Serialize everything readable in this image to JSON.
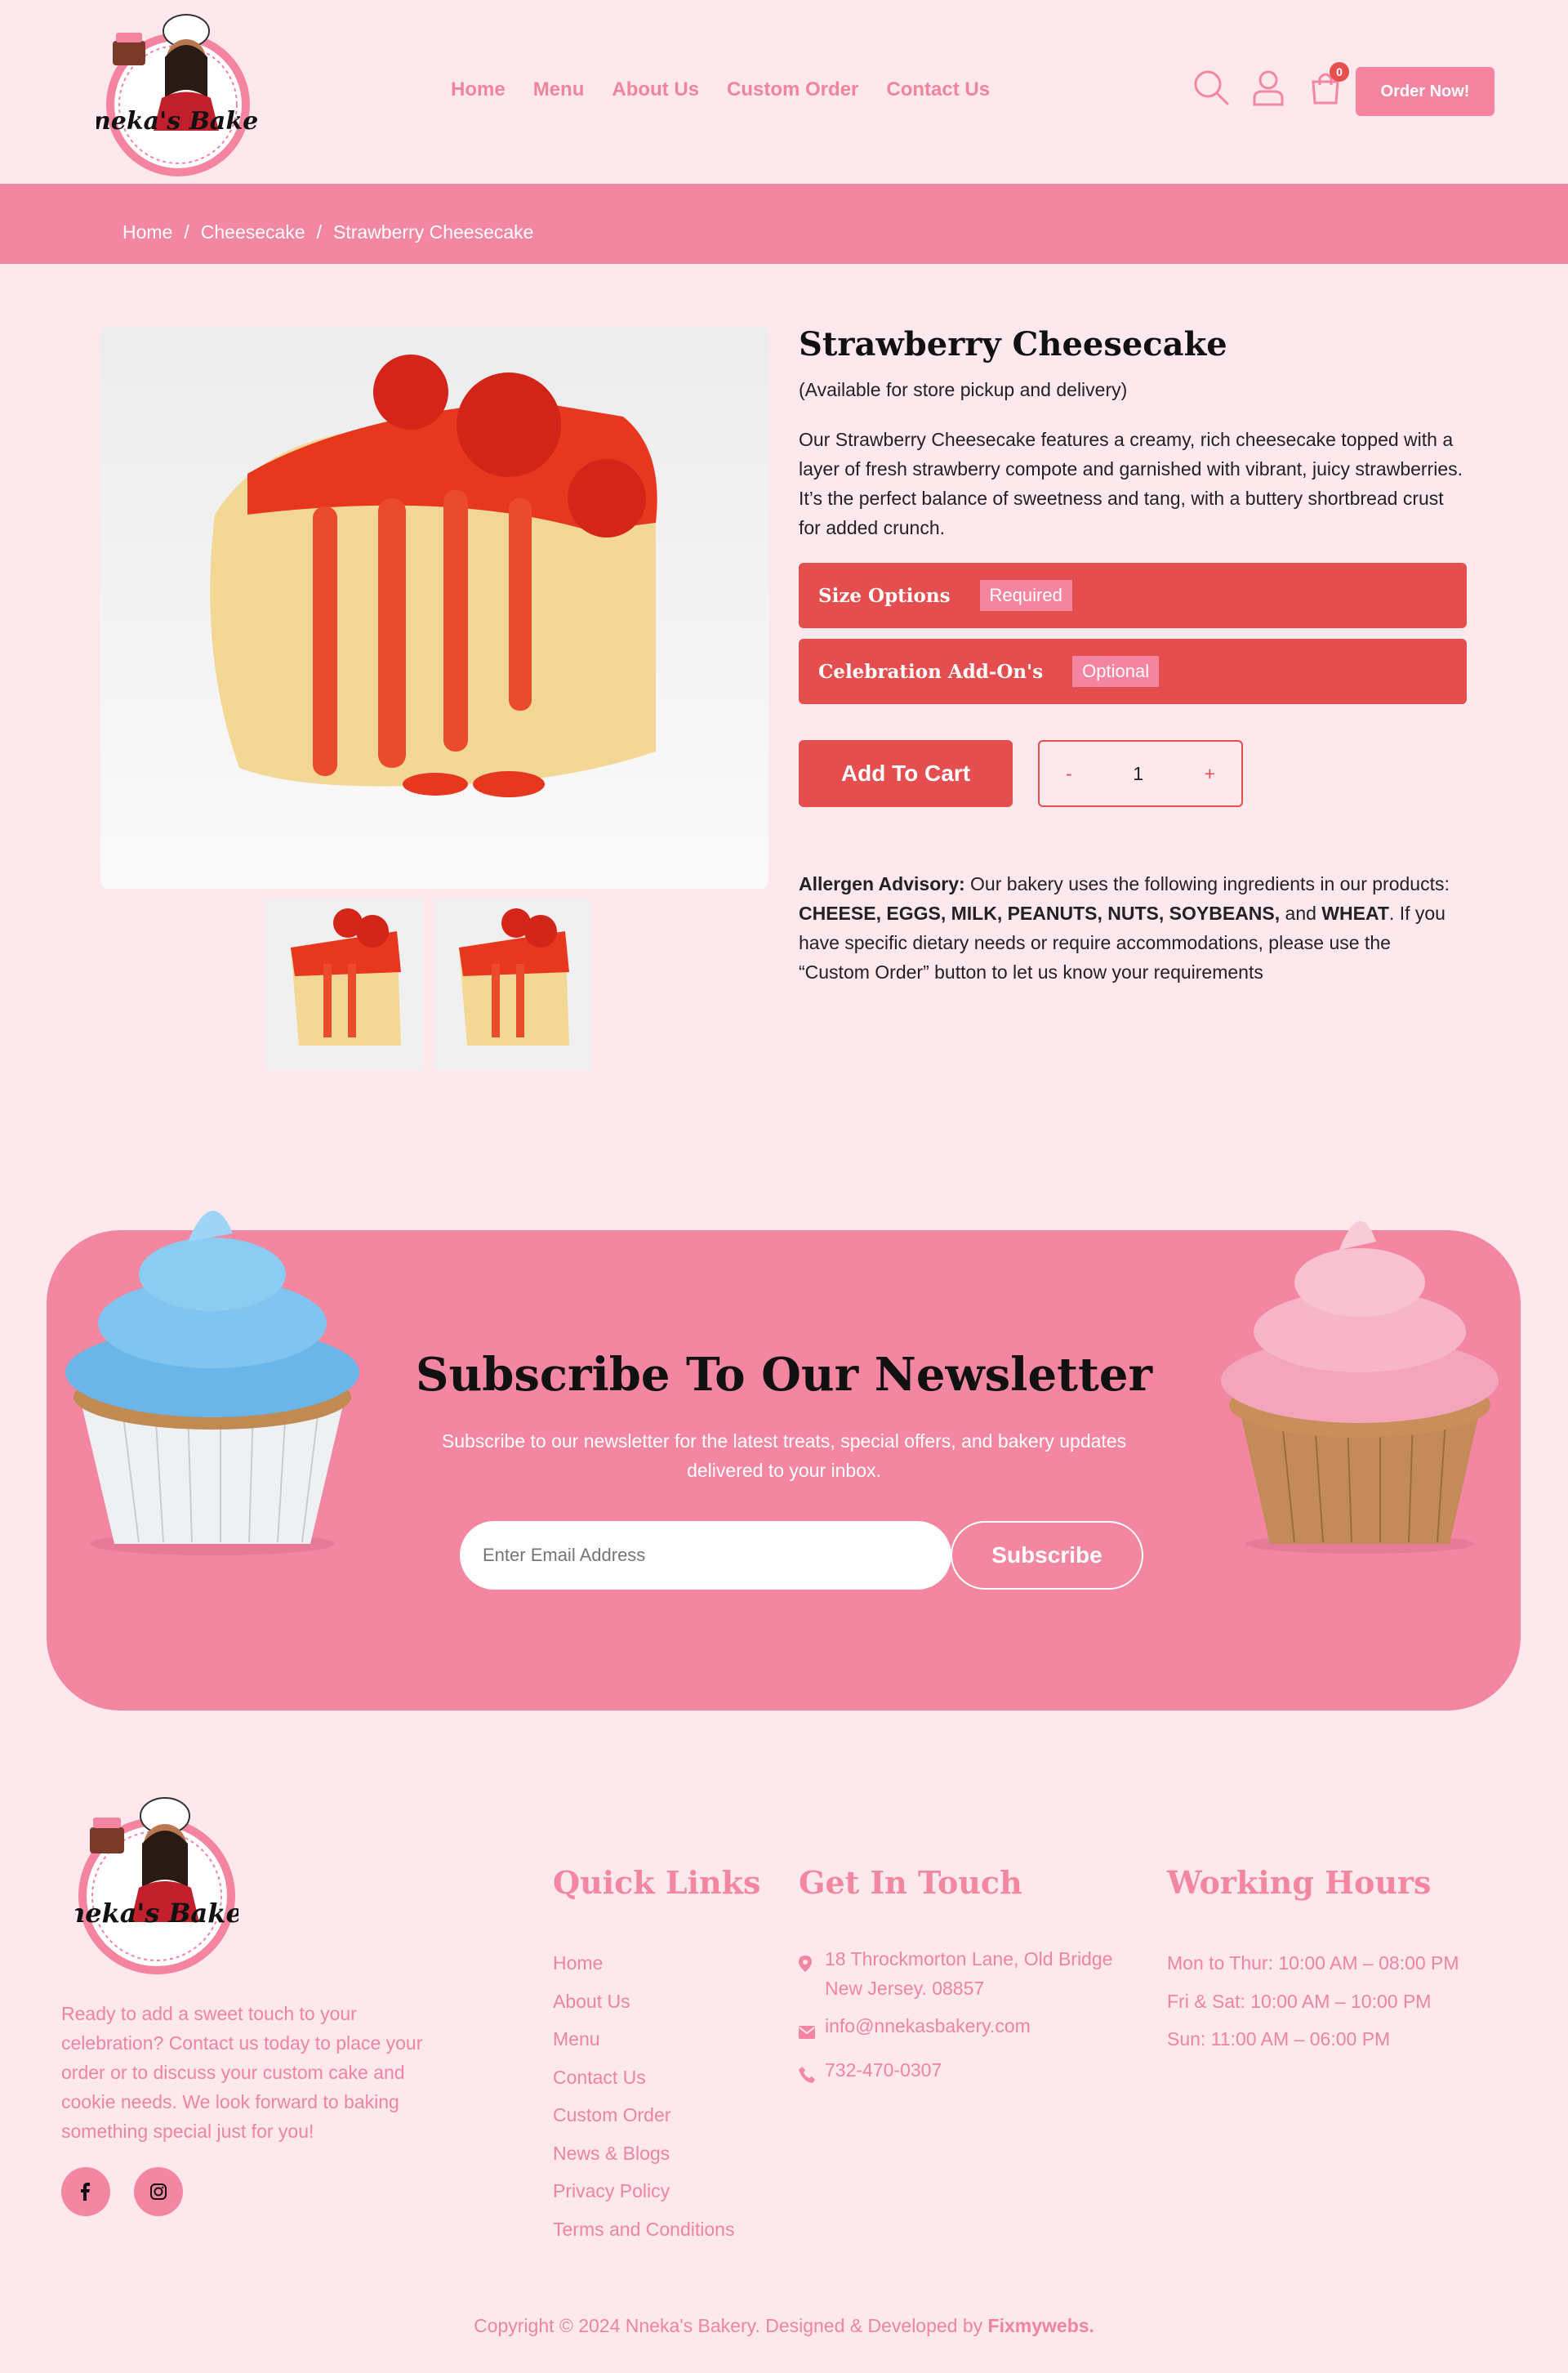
{
  "header": {
    "nav": [
      "Home",
      "Menu",
      "About Us",
      "Custom Order",
      "Contact Us"
    ],
    "cart_count": "0",
    "order_button": "Order Now!",
    "logo_text": "Nneka's Bakery"
  },
  "breadcrumb": [
    "Home",
    "/",
    "Cheesecake",
    "/",
    "Strawberry Cheesecake"
  ],
  "product": {
    "title": "Strawberry Cheesecake",
    "availability": "(Available for store pickup and delivery)",
    "description": "Our Strawberry Cheesecake features a creamy, rich cheesecake topped with a layer of fresh strawberry compote and garnished with vibrant, juicy strawberries. It’s the perfect balance of sweetness and tang, with a buttery shortbread crust for added crunch.",
    "options": [
      {
        "label": "Size Options",
        "tag": "Required"
      },
      {
        "label": "Celebration Add-On's",
        "tag": "Optional"
      }
    ],
    "add_to_cart": "Add To Cart",
    "qty_minus": "-",
    "qty_value": "1",
    "qty_plus": "+",
    "allergen": {
      "label": "Allergen Advisory:",
      "text1": " Our bakery uses the following ingredients in our products: ",
      "list": "CHEESE, EGGS, MILK, PEANUTS, NUTS, SOYBEANS,",
      "and": " and ",
      "last": "WHEAT",
      "text2": ". If you have specific dietary needs or require accommodations, please use the “Custom Order” button to let us know your requirements"
    }
  },
  "newsletter": {
    "title": "Subscribe To Our Newsletter",
    "text": "Subscribe to our newsletter for the latest treats, special offers, and bakery updates delivered to your inbox.",
    "placeholder": "Enter Email Address",
    "button": "Subscribe"
  },
  "footer": {
    "about": "Ready to add a sweet touch to your celebration? Contact us today to place your order or to discuss your custom cake and cookie needs. We look forward to baking something special just for you!",
    "quick_links_title": "Quick Links",
    "quick_links": [
      "Home",
      "About Us",
      "Menu",
      "Contact Us",
      "Custom Order",
      "News & Blogs",
      "Privacy Policy",
      "Terms and Conditions"
    ],
    "contact_title": "Get In Touch",
    "address_line1": "18 Throckmorton Lane, Old Bridge",
    "address_line2": "New Jersey. 08857",
    "email": "info@nnekasbakery.com",
    "phone": "732-470-0307",
    "hours_title": "Working Hours",
    "hours": [
      "Mon to Thur: 10:00 AM – 08:00 PM",
      "Fri & Sat: 10:00 AM – 10:00 PM",
      "Sun: 11:00 AM – 06:00 PM"
    ],
    "copyright": "Copyright © 2024 Nneka's Bakery. Designed & Developed by ",
    "developer": "Fixmywebs."
  },
  "colors": {
    "pink": "#f387a2",
    "red": "#e54e4f",
    "background": "#fde8ee"
  }
}
